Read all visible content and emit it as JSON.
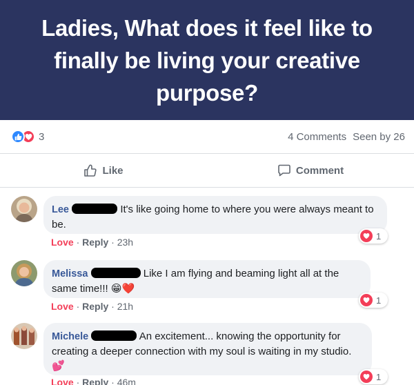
{
  "post": {
    "title": "Ladies, What does it feel like to finally be living your creative purpose?",
    "reaction_count": "3",
    "comments_count": "4 Comments",
    "seen_by": "Seen by 26"
  },
  "actions": {
    "like_label": "Like",
    "comment_label": "Comment"
  },
  "comments": [
    {
      "author": "Lee",
      "text": "It's like going home to where you were always meant to be.",
      "love_label": "Love",
      "reply_label": "Reply",
      "time": "23h",
      "reaction_count": "1"
    },
    {
      "author": "Melissa",
      "text": "Like I am flying and beaming light all at the same time!!!",
      "emoji": "😁❤️",
      "love_label": "Love",
      "reply_label": "Reply",
      "time": "21h",
      "reaction_count": "1"
    },
    {
      "author": "Michele",
      "text": "An excitement... knowing the opportunity for creating a deeper connection with my soul is waiting in my studio.",
      "emoji": "💕",
      "love_label": "Love",
      "reply_label": "Reply",
      "time": "46m",
      "reaction_count": "1"
    }
  ],
  "colors": {
    "header_bg": "#2b3460",
    "link_blue": "#385898",
    "love_red": "#f33e58",
    "like_blue": "#2d88ff"
  }
}
